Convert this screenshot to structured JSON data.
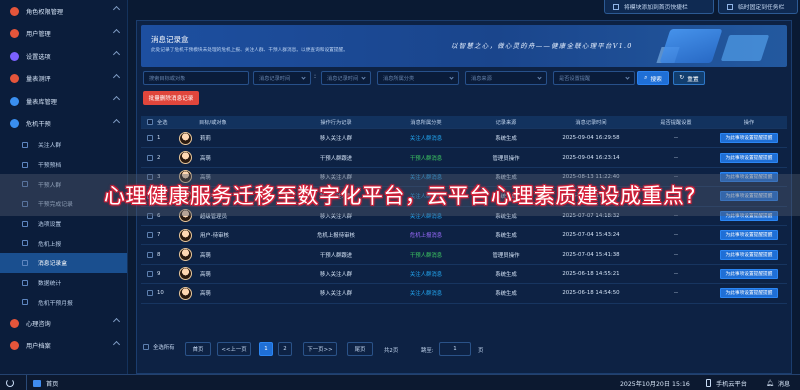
{
  "sidebar": {
    "top_items": [
      {
        "label": "角色权限管理",
        "icon": "shield-icon",
        "color": "#e4553b"
      },
      {
        "label": "用户管理",
        "icon": "user-icon",
        "color": "#e4553b"
      },
      {
        "label": "设置选项",
        "icon": "gear-icon",
        "color": "#7b61ff"
      },
      {
        "label": "量表测评",
        "icon": "clipboard-icon",
        "color": "#e4553b"
      },
      {
        "label": "量表库管理",
        "icon": "database-icon",
        "color": "#3a8ff0"
      },
      {
        "label": "危机干预",
        "icon": "alert-icon",
        "color": "#3a8ff0"
      }
    ],
    "sub_items": [
      {
        "label": "关注人群"
      },
      {
        "label": "干预预档"
      },
      {
        "label": "干预人群"
      },
      {
        "label": "干预完成记录"
      },
      {
        "label": "选项设置"
      },
      {
        "label": "危机上报"
      },
      {
        "label": "消息记录盒",
        "active": true
      },
      {
        "label": "数据统计"
      },
      {
        "label": "危机干预月报"
      }
    ],
    "bottom_items": [
      {
        "label": "心理咨询",
        "icon": "heart-icon",
        "color": "#e4553b"
      },
      {
        "label": "用户档案",
        "icon": "folder-icon",
        "color": "#e4553b"
      }
    ]
  },
  "topbar": {
    "quick_add": "将模块添加到首页快捷栏",
    "pin": "临时固定到任务栏"
  },
  "banner": {
    "title": "消息记录盒",
    "desc": "此处记录了危机干预模块未处理的危机上报、关注人群、干预人群消息。以便查询和设置提醒。",
    "slogan": "以智慧之心，做心灵的舟——健康全联心理平台V1.0"
  },
  "filters": {
    "target_placeholder": "搜索目标或对象",
    "date_start_placeholder": "消息记录时间",
    "date_end_placeholder": "消息记录时间",
    "category_placeholder": "消息所属分类",
    "source_placeholder": "消息来源",
    "remind_placeholder": "是否设置提醒",
    "search_label": "搜索",
    "reset_label": "重置",
    "batch_delete_label": "批量删除消息记录"
  },
  "table": {
    "headers": [
      "全选",
      "目标/或对象",
      "操作行为记录",
      "消息所属分类",
      "记录来源",
      "消息记录时间",
      "是否提醒设置",
      "操作"
    ],
    "rows": [
      {
        "no": "1",
        "name": "莉莉",
        "action": "移入关注人群",
        "category": "关注人群消息",
        "cat_color": "blue",
        "source": "系统生成",
        "time": "2025-09-04 16:29:58",
        "remind": "--",
        "op": "为此事项设置提醒提醒"
      },
      {
        "no": "2",
        "name": "高萌",
        "action": "干预人群跟进",
        "category": "干预人群消息",
        "cat_color": "green",
        "source": "管理员操作",
        "time": "2025-09-04 16:23:14",
        "remind": "--",
        "op": "为此事项设置提醒提醒"
      },
      {
        "no": "3",
        "name": "高萌",
        "action": "移入关注人群",
        "category": "关注人群消息",
        "cat_color": "blue",
        "source": "系统生成",
        "time": "2025-08-13 11:22:40",
        "remind": "--",
        "op": "为此事项设置提醒提醒"
      },
      {
        "no": "5",
        "name": "谭德华",
        "action": "移入关注人群",
        "category": "关注人群消息",
        "cat_color": "blue",
        "source": "系统生成",
        "time": "2025-07-09 17:41:50",
        "remind": "--",
        "op": "为此事项设置提醒提醒"
      },
      {
        "no": "6",
        "name": "超级管理员",
        "action": "移入关注人群",
        "category": "关注人群消息",
        "cat_color": "blue",
        "source": "系统生成",
        "time": "2025-07-07 14:18:32",
        "remind": "--",
        "op": "为此事项设置提醒提醒"
      },
      {
        "no": "7",
        "name": "用户-待审核",
        "action": "危机上报待审核",
        "category": "危机上报消息",
        "cat_color": "purple",
        "source": "系统生成",
        "time": "2025-07-04 15:43:24",
        "remind": "--",
        "op": "为此事项设置提醒提醒"
      },
      {
        "no": "8",
        "name": "高萌",
        "action": "干预人群跟进",
        "category": "干预人群消息",
        "cat_color": "green",
        "source": "管理员操作",
        "time": "2025-07-04 15:41:38",
        "remind": "--",
        "op": "为此事项设置提醒提醒"
      },
      {
        "no": "9",
        "name": "高萌",
        "action": "移入关注人群",
        "category": "关注人群消息",
        "cat_color": "blue",
        "source": "系统生成",
        "time": "2025-06-18 14:55:21",
        "remind": "--",
        "op": "为此事项设置提醒提醒"
      },
      {
        "no": "10",
        "name": "高萌",
        "action": "移入关注人群",
        "category": "关注人群消息",
        "cat_color": "blue",
        "source": "系统生成",
        "time": "2025-06-18 14:54:50",
        "remind": "--",
        "op": "为此事项设置提醒提醒"
      }
    ]
  },
  "pager": {
    "select_all": "全选所有",
    "first": "首页",
    "prev": "<<上一页",
    "pages": [
      "1",
      "2"
    ],
    "current": "1",
    "next": "下一页>>",
    "last": "尾页",
    "total": "共2页",
    "jump_label": "跳至:",
    "jump_value": "1",
    "page_unit": "页"
  },
  "overlay": {
    "caption": "心理健康服务迁移至数字化平台，云平台心理素质建设成重点?"
  },
  "taskbar": {
    "home": "首页",
    "datetime": "2025年10月20日 15:16",
    "mobile": "手机云平台",
    "message": "消息"
  }
}
